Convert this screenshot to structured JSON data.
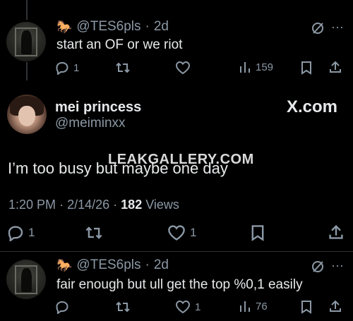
{
  "reply1": {
    "handle": "@TES6pls",
    "separator": "·",
    "time": "2d",
    "text": "start an OF or we riot",
    "replies": "1",
    "retweets": "",
    "likes": "",
    "views": "159",
    "author_icon": "horse-emoji",
    "grok_icon": "grok-icon",
    "more_icon": "more-icon"
  },
  "main": {
    "name": "mei princess",
    "handle": "@meiminxx",
    "brand": "X.com",
    "text": "I’m too busy but maybe one day",
    "watermark": "LEAKGALLERY.COM",
    "time": "1:20 PM",
    "dot": "·",
    "date": "2/14/26",
    "dot2": "·",
    "views_count": "182",
    "views_label": "Views",
    "replies": "1",
    "likes": "1"
  },
  "reply2": {
    "handle": "@TES6pls",
    "separator": "·",
    "time": "2d",
    "text": "fair enough but ull get the top %0,1 easily",
    "replies": "",
    "likes": "1",
    "views": "76",
    "author_icon": "horse-emoji"
  },
  "colors": {
    "background": "#000000",
    "text": "#e7e9ea",
    "muted": "#8b98a5",
    "divider": "#2f3336"
  }
}
